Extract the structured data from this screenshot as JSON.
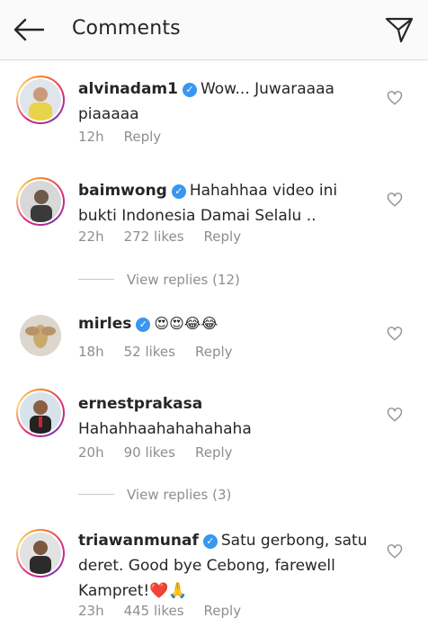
{
  "header": {
    "title": "Comments",
    "back_icon": "back-arrow-icon",
    "dm_icon": "direct-message-icon"
  },
  "comments": [
    {
      "user": "alvinadam1",
      "verified": true,
      "text": "Wow... Juwaraaaa piaaaaa",
      "time": "12h",
      "likes": "",
      "reply": "Reply",
      "avatar_bg": "#e8d34a"
    },
    {
      "user": "baimwong",
      "verified": true,
      "text": "Hahahhaa video ini bukti Indonesia Damai Selalu ..",
      "time": "22h",
      "likes": "272 likes",
      "reply": "Reply",
      "avatar_bg": "#555555"
    },
    {
      "user": "mirles",
      "verified": true,
      "text": "😍😍😂😂",
      "time": "18h",
      "likes": "52 likes",
      "reply": "Reply",
      "avatar_bg": "#c9a96e"
    },
    {
      "user": "ernestprakasa",
      "verified": false,
      "text": "Hahahhaahahahahaha",
      "time": "20h",
      "likes": "90 likes",
      "reply": "Reply",
      "avatar_bg": "#333333"
    },
    {
      "user": "triawanmunaf",
      "verified": true,
      "text": "Satu gerbong, satu deret. Good bye Cebong, farewell Kampret!❤️🙏",
      "time": "23h",
      "likes": "445 likes",
      "reply": "Reply",
      "avatar_bg": "#444444"
    }
  ],
  "view_replies": [
    {
      "label": "View replies (12)"
    },
    {
      "label": "View replies (3)"
    }
  ],
  "colors": {
    "verified": "#3897f0",
    "meta": "#8e8e8e",
    "text": "#262626"
  }
}
